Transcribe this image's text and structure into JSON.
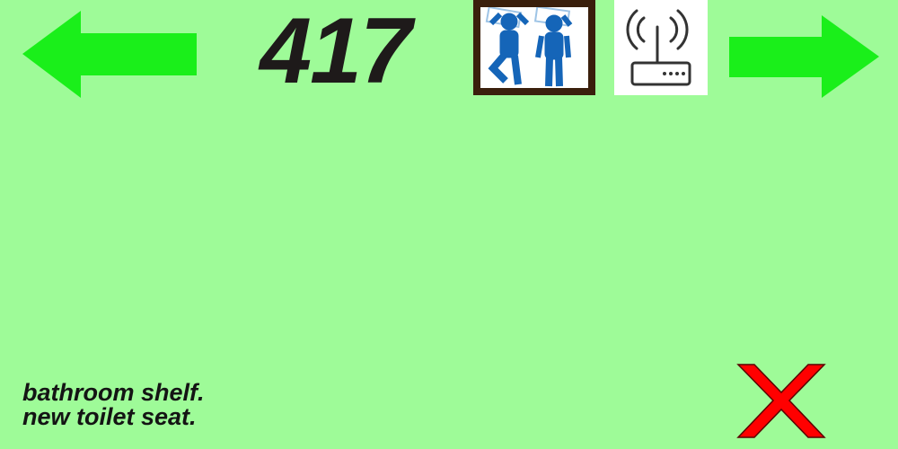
{
  "counter": {
    "value": "417"
  },
  "nav": {
    "prev_icon": "arrow-left-icon",
    "next_icon": "arrow-right-icon",
    "arrow_color": "#1aef1a"
  },
  "icons": {
    "sleep": "sleeping-couple-icon",
    "router": "wifi-router-icon"
  },
  "notes": {
    "lines": [
      "bathroom shelf.",
      "new toilet seat."
    ]
  },
  "close": {
    "icon": "close-x-icon",
    "color": "#ff0000"
  },
  "colors": {
    "background": "#9efb98"
  }
}
